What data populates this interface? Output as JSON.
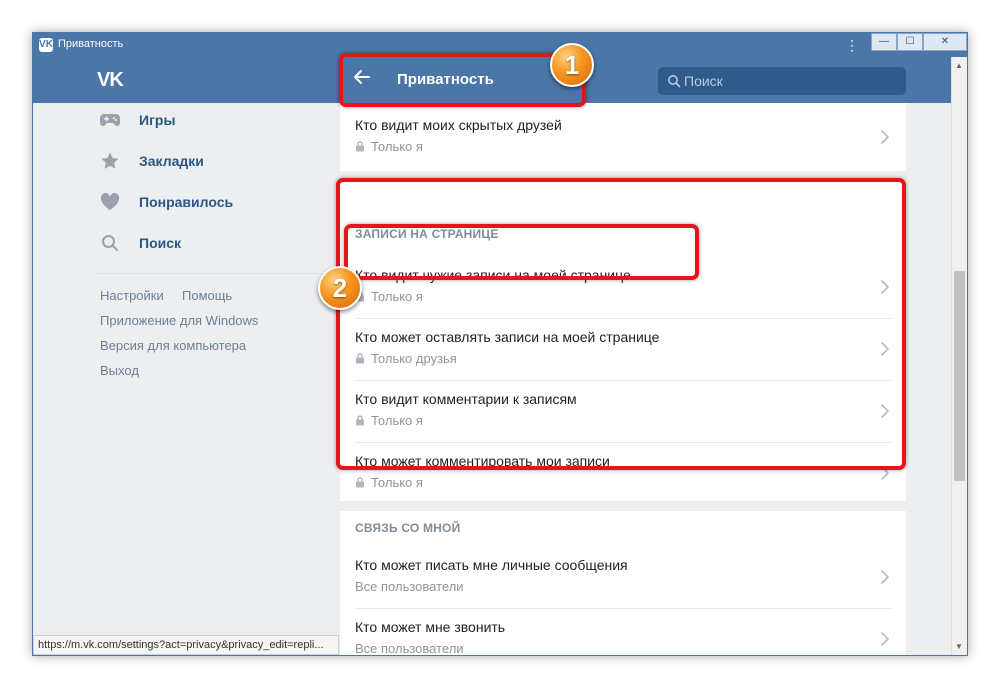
{
  "window": {
    "title": "Приватность",
    "logo_text": "VK",
    "controls": {
      "minimize": "—",
      "maximize": "☐",
      "close": "✕"
    }
  },
  "header": {
    "logo": "VK",
    "title": "Приватность",
    "search": {
      "placeholder": "Поиск"
    }
  },
  "sidebar": {
    "items": [
      {
        "label": "Игры",
        "icon": "gamepad-icon"
      },
      {
        "label": "Закладки",
        "icon": "star-icon"
      },
      {
        "label": "Понравилось",
        "icon": "heart-icon"
      },
      {
        "label": "Поиск",
        "icon": "search-icon"
      }
    ],
    "links": {
      "settings": "Настройки",
      "help": "Помощь",
      "windows_app": "Приложение для Windows",
      "desktop_version": "Версия для компьютера",
      "logout": "Выход"
    }
  },
  "content": {
    "top_row": {
      "title": "Кто видит моих скрытых друзей",
      "value": "Только я"
    },
    "sections": [
      {
        "heading": "Записи на странице",
        "rows": [
          {
            "title": "Кто видит чужие записи на моей странице",
            "value": "Только я"
          },
          {
            "title": "Кто может оставлять записи на моей странице",
            "value": "Только друзья"
          },
          {
            "title": "Кто видит комментарии к записям",
            "value": "Только я"
          },
          {
            "title": "Кто может комментировать мои записи",
            "value": "Только я"
          }
        ]
      },
      {
        "heading": "Связь со мной",
        "rows": [
          {
            "title": "Кто может писать мне личные сообщения",
            "value": "Все пользователи"
          },
          {
            "title": "Кто может мне звонить",
            "value": "Все пользователи"
          }
        ]
      }
    ]
  },
  "status_url": "https://m.vk.com/settings?act=privacy&privacy_edit=repli...",
  "annotations": {
    "badge_1": "1",
    "badge_2": "2"
  },
  "colors": {
    "brand": "#4a76a8",
    "annotation": "#e8141b",
    "link": "#2a5885"
  }
}
